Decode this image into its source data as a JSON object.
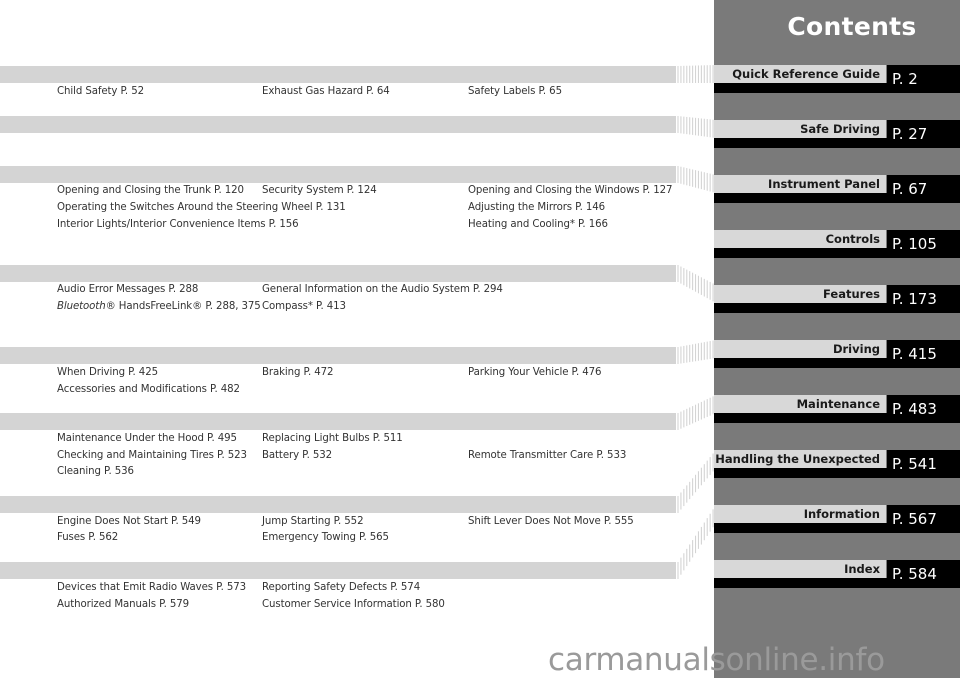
{
  "title": "Contents",
  "nav": [
    {
      "label": "Quick Reference Guide",
      "page": "P. 2"
    },
    {
      "label": "Safe Driving",
      "page": "P. 27"
    },
    {
      "label": "Instrument Panel",
      "page": "P. 67"
    },
    {
      "label": "Controls",
      "page": "P. 105"
    },
    {
      "label": "Features",
      "page": "P. 173"
    },
    {
      "label": "Driving",
      "page": "P. 415"
    },
    {
      "label": "Maintenance",
      "page": "P. 483"
    },
    {
      "label": "Handling the Unexpected",
      "page": "P. 541"
    },
    {
      "label": "Information",
      "page": "P. 567"
    },
    {
      "label": "Index",
      "page": "P. 584"
    }
  ],
  "sections": {
    "safe_driving": [
      "Child Safety P. 52",
      "Exhaust Gas Hazard P. 64",
      "Safety Labels P. 65"
    ],
    "controls": [
      "Opening and Closing the Trunk P. 120",
      "Security System P. 124",
      "Opening and Closing the Windows P. 127",
      "Operating the Switches Around the Steering Wheel P. 131",
      "Adjusting the Mirrors P. 146",
      "Interior Lights/Interior Convenience Items P. 156",
      "Heating and Cooling* P. 166"
    ],
    "features": [
      "Audio Error Messages P. 288",
      "General Information on the Audio System P. 294",
      "Bluetooth",
      "® HandsFreeLink® P. 288, 375",
      "Compass* P. 413"
    ],
    "driving": [
      "When Driving P. 425",
      "Braking P. 472",
      "Parking Your Vehicle P. 476",
      "Accessories and Modifications P. 482"
    ],
    "maintenance": [
      "Maintenance Under the Hood P. 495",
      "Replacing Light Bulbs P. 511",
      "Checking and Maintaining Tires P. 523",
      "Battery P. 532",
      "Remote Transmitter Care P. 533",
      "Cleaning P. 536"
    ],
    "handling": [
      "Engine Does Not Start P. 549",
      "Jump Starting P. 552",
      "Shift Lever Does Not Move P. 555",
      "Fuses P. 562",
      "Emergency Towing P. 565"
    ],
    "information": [
      "Devices that Emit Radio Waves P. 573",
      "Reporting Safety Defects P. 574",
      "Authorized Manuals P. 579",
      "Customer Service Information P. 580"
    ]
  },
  "watermark": "carmanualsonline.info"
}
